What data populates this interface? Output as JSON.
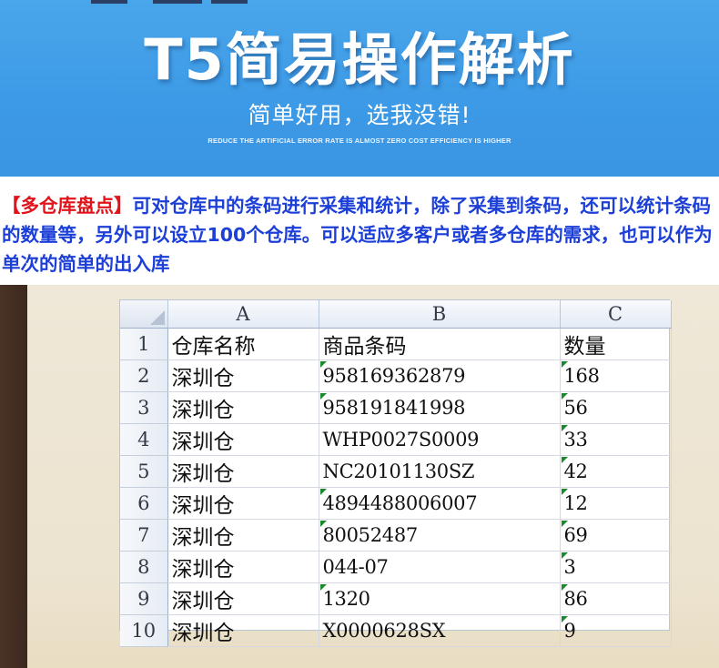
{
  "banner": {
    "title": "T5简易操作解析",
    "subtitle": "简单好用，选我没错!",
    "tagline": "REDUCE THE ARTIFICIAL ERROR RATE IS ALMOST ZERO COST EFFICIENCY IS HIGHER"
  },
  "description": {
    "tag": "【多仓库盘点】",
    "text": "可对仓库中的条码进行采集和统计，除了采集到条码，还可以统计条码的数量等，另外可以设立100个仓库。可以适应多客户或者多仓库的需求，也可以作为单次的简单的出入库"
  },
  "spreadsheet": {
    "columns": [
      "A",
      "B",
      "C"
    ],
    "header_row": {
      "num": "1",
      "cells": [
        "仓库名称",
        "商品条码",
        "数量"
      ]
    },
    "rows": [
      {
        "num": "2",
        "name": "深圳仓",
        "barcode": "958169362879",
        "qty": "168"
      },
      {
        "num": "3",
        "name": "深圳仓",
        "barcode": "958191841998",
        "qty": "56"
      },
      {
        "num": "4",
        "name": "深圳仓",
        "barcode": "WHP0027S0009",
        "qty": "33"
      },
      {
        "num": "5",
        "name": "深圳仓",
        "barcode": "NC20101130SZ",
        "qty": "42"
      },
      {
        "num": "6",
        "name": "深圳仓",
        "barcode": "4894488006007",
        "qty": "12"
      },
      {
        "num": "7",
        "name": "深圳仓",
        "barcode": "80052487",
        "qty": "69"
      },
      {
        "num": "8",
        "name": "深圳仓",
        "barcode": "044-07",
        "qty": "3"
      },
      {
        "num": "9",
        "name": "深圳仓",
        "barcode": "1320",
        "qty": "86"
      },
      {
        "num": "10",
        "name": "深圳仓",
        "barcode": "X0000628SX",
        "qty": "9"
      }
    ]
  },
  "colors": {
    "banner_blue": "#3d9ae6",
    "desc_blue": "#1c3fd8",
    "tag_red": "#e0141a",
    "text_cell_flag": "#1b8a2e"
  },
  "icons": {
    "select_all": "select-all-triangle-icon",
    "text_flag": "text-number-flag-icon"
  }
}
